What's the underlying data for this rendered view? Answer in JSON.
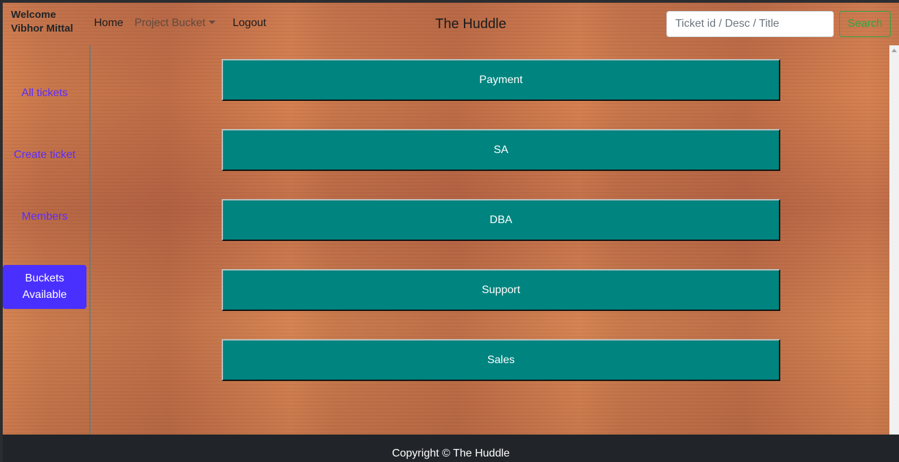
{
  "navbar": {
    "welcome_line1": "Welcome",
    "welcome_line2": "Vibhor Mittal",
    "home_label": "Home",
    "project_bucket_label": "Project Bucket",
    "logout_label": "Logout",
    "brand_title": "The Huddle",
    "search_placeholder": "Ticket id / Desc / Title",
    "search_label": "Search"
  },
  "sidebar": {
    "items": [
      {
        "label": "All tickets"
      },
      {
        "label": "Create ticket"
      },
      {
        "label": "Members"
      }
    ],
    "active_line1": "Buckets",
    "active_line2": "Available"
  },
  "buckets": [
    {
      "label": "Payment"
    },
    {
      "label": "SA"
    },
    {
      "label": "DBA"
    },
    {
      "label": "Support"
    },
    {
      "label": "Sales"
    }
  ],
  "footer": {
    "text": "Copyright © The Huddle"
  },
  "colors": {
    "bucket_bg": "#00847f",
    "sidebar_active_bg": "#4a30ff",
    "sidebar_link": "#5a2cff",
    "search_button": "#28a745",
    "footer_bg": "#212529"
  }
}
